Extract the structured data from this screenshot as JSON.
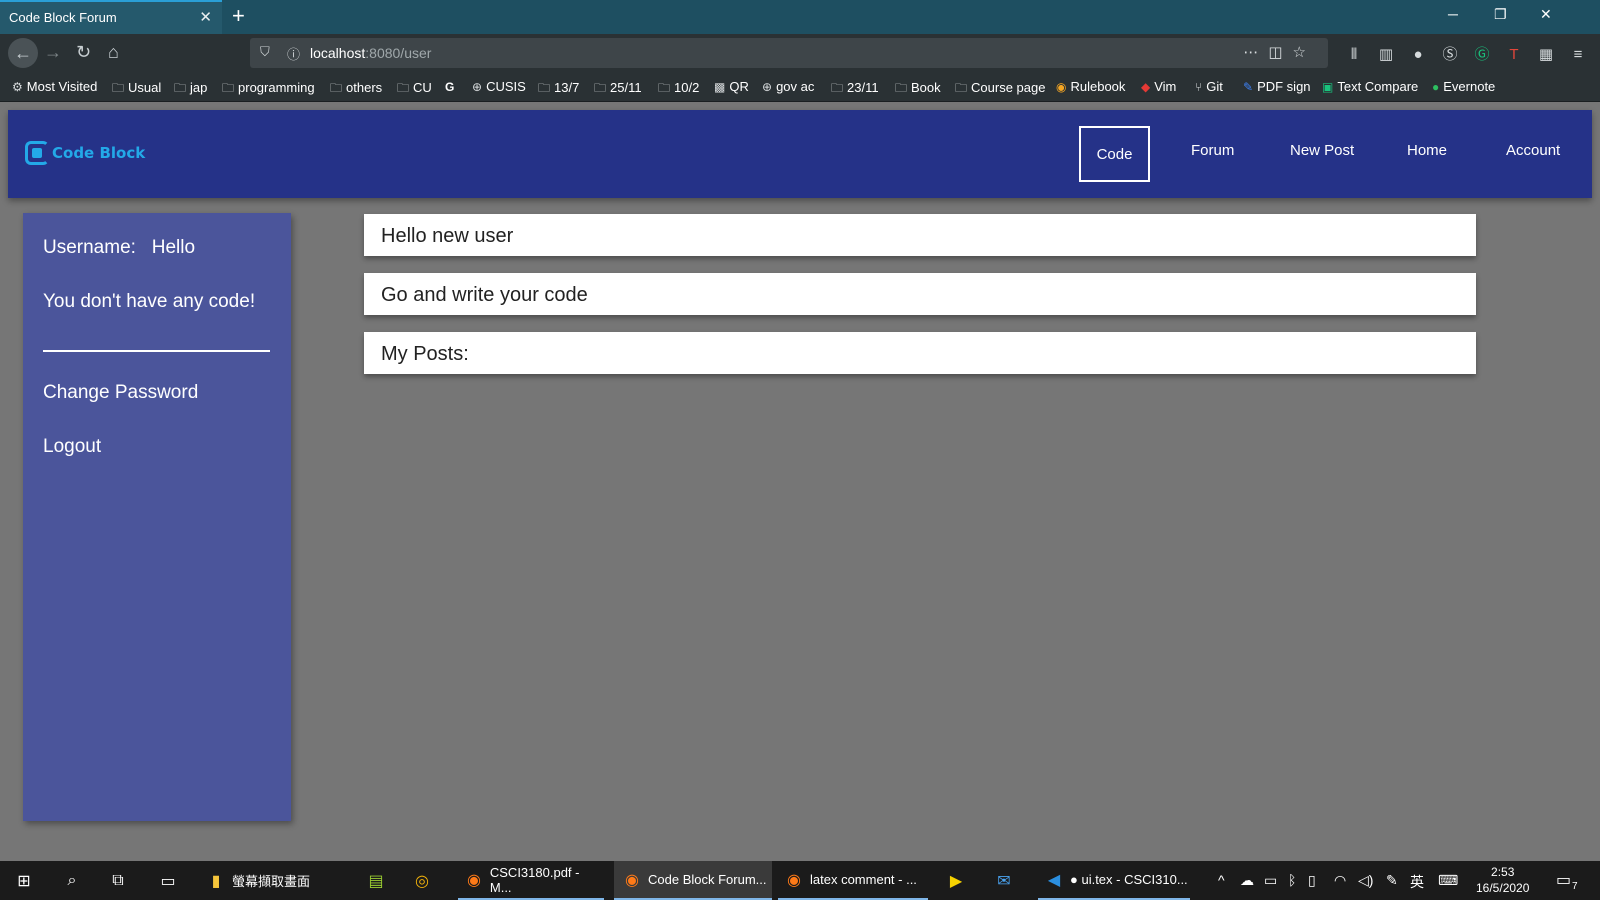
{
  "browser": {
    "tab_title": "Code Block Forum",
    "url_host": "localhost",
    "url_port_path": ":8080/user",
    "bookmarks": [
      "Most Visited",
      "Usual",
      "jap",
      "programming",
      "others",
      "CU",
      "CUSIS",
      "13/7",
      "25/11",
      "10/2",
      "QR",
      "gov ac",
      "23/11",
      "Book",
      "Course page",
      "Rulebook",
      "Vim",
      "Git",
      "PDF sign",
      "Text Compare",
      "Evernote"
    ]
  },
  "app": {
    "logo_text": "Code Block",
    "nav": [
      "Code",
      "Forum",
      "New Post",
      "Home",
      "Account"
    ],
    "active_nav": "Code"
  },
  "sidebar": {
    "username_label": "Username:",
    "username_value": "Hello",
    "no_code_message": "You don't have any code!",
    "change_password": "Change Password",
    "logout": "Logout"
  },
  "main": {
    "cards": [
      "Hello new user",
      "Go and write your code",
      "My Posts:"
    ]
  },
  "taskbar": {
    "items": [
      "螢幕擷取畫面",
      "CSCI3180.pdf - M...",
      "Code Block Forum...",
      "latex comment - ...",
      "● ui.tex - CSCI310..."
    ],
    "ime": "英",
    "time": "2:53",
    "date": "16/5/2020",
    "notification_count": "7"
  },
  "colors": {
    "header_bg": "#253288",
    "sidebar_bg": "#4b559b",
    "page_bg": "#767676",
    "logo_accent": "#23a9e8"
  }
}
